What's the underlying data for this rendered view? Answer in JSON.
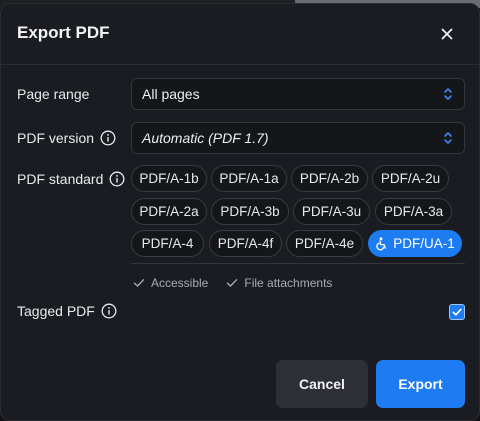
{
  "dialog": {
    "title": "Export PDF"
  },
  "page_range": {
    "label": "Page range",
    "value": "All pages"
  },
  "pdf_version": {
    "label": "PDF version",
    "value": "Automatic (PDF 1.7)"
  },
  "pdf_standard": {
    "label": "PDF standard",
    "options": [
      "PDF/A-1b",
      "PDF/A-1a",
      "PDF/A-2b",
      "PDF/A-2u",
      "PDF/A-2a",
      "PDF/A-3b",
      "PDF/A-3u",
      "PDF/A-3a",
      "PDF/A-4",
      "PDF/A-4f",
      "PDF/A-4e",
      "PDF/UA-1"
    ],
    "selected": "PDF/UA-1",
    "selected_icon": "accessibility-icon",
    "features": [
      "Accessible",
      "File attachments"
    ]
  },
  "tagged_pdf": {
    "label": "Tagged PDF",
    "checked": true
  },
  "buttons": {
    "cancel": "Cancel",
    "export": "Export"
  },
  "colors": {
    "accent": "#1d7cf2",
    "background": "#1b1c21"
  },
  "icons": {
    "close": "close-icon",
    "info": "info-icon",
    "select_chevrons": "chevron-up-down-icon",
    "check": "check-icon"
  }
}
